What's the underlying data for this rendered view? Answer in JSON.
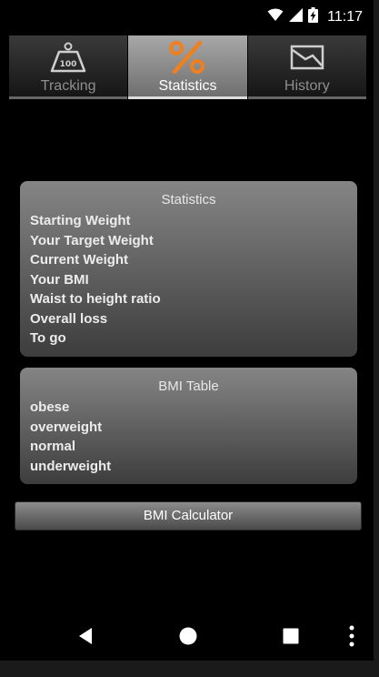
{
  "status_bar": {
    "time": "11:17",
    "icons": [
      "wifi-icon",
      "cell-signal-icon",
      "battery-charging-icon"
    ]
  },
  "tabs": [
    {
      "label": "Tracking",
      "icon": "scale-weight-icon",
      "active": false
    },
    {
      "label": "Statistics",
      "icon": "percent-icon",
      "active": true
    },
    {
      "label": "History",
      "icon": "chart-icon",
      "active": false
    }
  ],
  "statistics": {
    "title": "Statistics",
    "rows": [
      "Starting Weight",
      "Your Target Weight",
      "Current Weight",
      "Your BMI",
      "Waist to height ratio",
      "Overall loss",
      "To go"
    ]
  },
  "bmi_table": {
    "title": "BMI Table",
    "rows": [
      "obese",
      "overweight",
      "normal",
      "underweight"
    ]
  },
  "calculator_button": {
    "label": "BMI Calculator"
  },
  "nav_bar": {
    "buttons": [
      "back-icon",
      "home-icon",
      "recents-icon",
      "overflow-menu-icon"
    ]
  },
  "colors": {
    "background": "#000000",
    "accent_orange": "#f07f1e",
    "card_top": "#858585",
    "card_bottom": "#3d3d3d",
    "active_tab": "#a8a8a8"
  }
}
